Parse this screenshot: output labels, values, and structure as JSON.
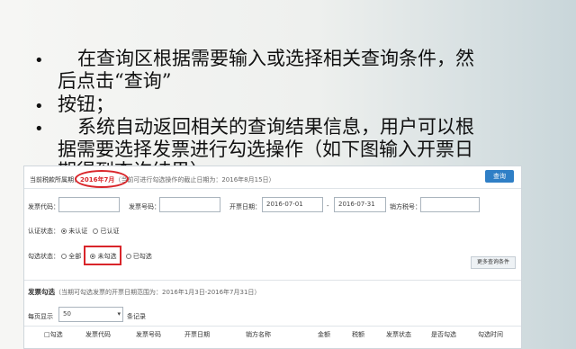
{
  "bullets": [
    {
      "marker": "•",
      "line1": "在查询区根据需要输入或选择相关查询条件，然",
      "line2": "后点击“查询”"
    },
    {
      "marker": "•",
      "line1": "按钮；"
    },
    {
      "marker": "•",
      "line1": "系统自动返回相关的查询结果信息，用户可以根",
      "line2": "据需要选择发票进行勾选操作（如下图输入开票日",
      "line3": "期得到查询结果）"
    }
  ],
  "panel": {
    "period_label": "当前税款所属期：",
    "period_value": "2016年7月",
    "period_note": "（当前可进行勾选操作的截止日期为：2016年8月15日）",
    "query_button": "查询",
    "fields": {
      "invoice_code": "发票代码：",
      "invoice_number": "发票号码：",
      "date_label": "开票日期：",
      "date_from": "2016-07-01",
      "date_sep": "-",
      "date_to": "2016-07-31",
      "seller_tax": "销方税号："
    },
    "auth_label": "认证状态：",
    "auth_opts": [
      "未认证",
      "已认证"
    ],
    "check_label": "勾选状态：",
    "check_opts": [
      "全部",
      "未勾选",
      "已勾选"
    ],
    "more_button": "更多查询条件",
    "section_title": "发票勾选",
    "section_note": "（当期可勾选发票的开票日期范围为：2016年1月3日-2016年7月31日）",
    "per_page_label": "每页显示",
    "per_page_value": "50",
    "per_page_suffix": "条记录",
    "columns": [
      "□勾选",
      "发票代码",
      "发票号码",
      "开票日期",
      "销方名称",
      "金额",
      "税额",
      "发票状态",
      "是否勾选",
      "勾选时间"
    ]
  }
}
